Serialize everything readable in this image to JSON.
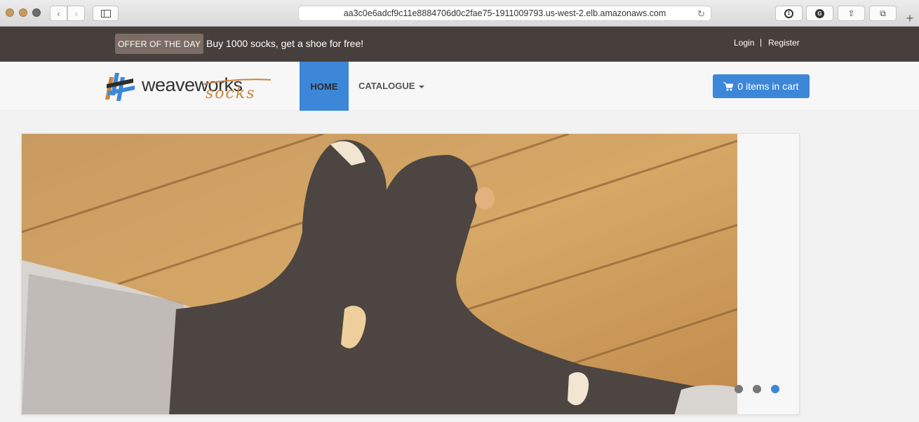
{
  "browser": {
    "url": "aa3c0e6adcf9c11e8884706d0c2fae75-1911009793.us-west-2.elb.amazonaws.com",
    "back_glyph": "‹",
    "forward_glyph": "›",
    "reload_glyph": "↻",
    "newtab_glyph": "+",
    "ext_1password": "1",
    "ext_grammarly": "G",
    "share_glyph": "⇧",
    "tabs_glyph": "⧉"
  },
  "topbar": {
    "offer_label": "OFFER OF THE DAY",
    "offer_text": "Buy 1000 socks, get a shoe for free!",
    "login": "Login",
    "separator": "|",
    "register": "Register"
  },
  "navbar": {
    "logo_weave": "weaveworks",
    "logo_socks": "socks",
    "home": "HOME",
    "catalogue": "CATALOGUE",
    "cart_icon": "🛒",
    "cart_label": "0 items in cart"
  },
  "carousel": {
    "active_slide": 3,
    "slide_count": 3
  },
  "colors": {
    "topbar_bg": "#473f3c",
    "accent_blue": "#3d87d9",
    "offer_badge": "#7b6d65",
    "logo_orange": "#c8853e"
  }
}
